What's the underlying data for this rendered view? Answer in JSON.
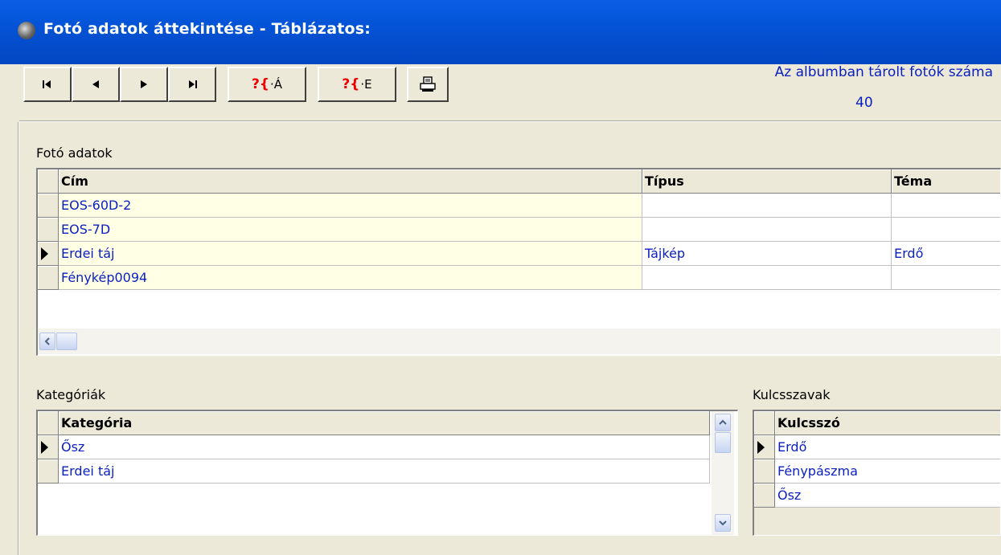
{
  "window": {
    "title": "Fotó adatok áttekintése - Táblázatos:"
  },
  "toolbar": {
    "first": "first-record",
    "prev": "previous-record",
    "next": "next-record",
    "last": "last-record",
    "search_a_q": "?{",
    "search_a_rest": "·Á",
    "search_e_q": "?{",
    "search_e_rest": "·E",
    "print": "print"
  },
  "album": {
    "label": "Az albumban tárolt fotók száma",
    "count": "40"
  },
  "photos": {
    "group_label": "Fotó adatok",
    "columns": [
      "Cím",
      "Típus",
      "Téma"
    ],
    "rows": [
      {
        "cim": "EOS-60D-2",
        "tipus": "",
        "tema": "",
        "current": false
      },
      {
        "cim": "EOS-7D",
        "tipus": "",
        "tema": "",
        "current": false
      },
      {
        "cim": "Erdei táj",
        "tipus": "Tájkép",
        "tema": "Erdő",
        "current": true
      },
      {
        "cim": "Fénykép0094",
        "tipus": "",
        "tema": "",
        "current": false
      }
    ]
  },
  "categories": {
    "group_label": "Kategóriák",
    "column": "Kategória",
    "rows": [
      {
        "value": "Ősz",
        "current": true
      },
      {
        "value": "Erdei táj",
        "current": false
      }
    ]
  },
  "keywords": {
    "group_label": "Kulcsszavak",
    "column": "Kulcsszó",
    "rows": [
      {
        "value": "Erdő",
        "current": true
      },
      {
        "value": "Fénypászma",
        "current": false
      },
      {
        "value": "Ősz",
        "current": false
      }
    ]
  }
}
